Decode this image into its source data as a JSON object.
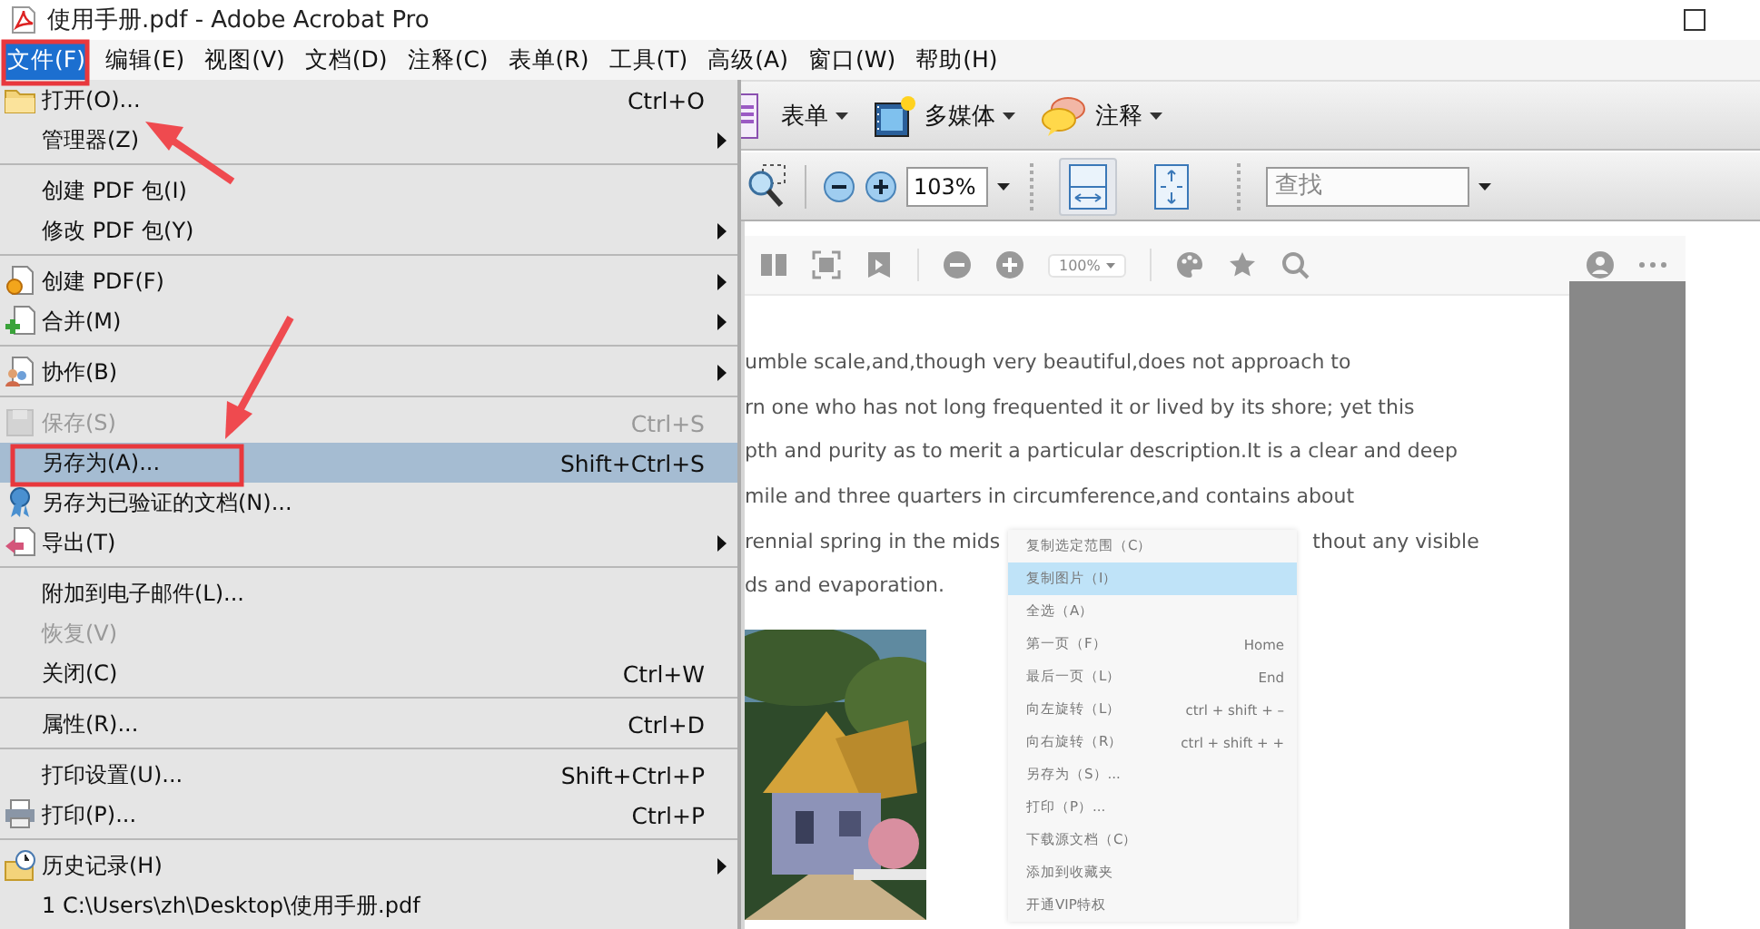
{
  "window": {
    "title": "使用手册.pdf - Adobe Acrobat Pro"
  },
  "menu_bar": [
    {
      "label": "文件(F)",
      "selected": true
    },
    {
      "label": "编辑(E)",
      "selected": false
    },
    {
      "label": "视图(V)",
      "selected": false
    },
    {
      "label": "文档(D)",
      "selected": false
    },
    {
      "label": "注释(C)",
      "selected": false
    },
    {
      "label": "表单(R)",
      "selected": false
    },
    {
      "label": "工具(T)",
      "selected": false
    },
    {
      "label": "高级(A)",
      "selected": false
    },
    {
      "label": "窗口(W)",
      "selected": false
    },
    {
      "label": "帮助(H)",
      "selected": false
    }
  ],
  "task_toolbar": [
    {
      "label": "表单"
    },
    {
      "label": "多媒体"
    },
    {
      "label": "注释"
    }
  ],
  "view_toolbar": {
    "zoom": "103%",
    "fit_buttons": [
      {
        "selected": true
      },
      {
        "selected": false
      }
    ],
    "search": {
      "placeholder": "查找"
    }
  },
  "file_menu": [
    [
      {
        "label": "打开(O)...",
        "shortcut": "Ctrl+O",
        "submenu": false,
        "disabled": false,
        "selected": false
      },
      {
        "label": "管理器(Z)",
        "submenu": true,
        "disabled": false,
        "selected": false
      }
    ],
    [
      {
        "label": "创建 PDF 包(I)",
        "submenu": false,
        "disabled": false,
        "selected": false
      },
      {
        "label": "修改 PDF 包(Y)",
        "submenu": true,
        "disabled": false,
        "selected": false
      }
    ],
    [
      {
        "label": "创建 PDF(F)",
        "submenu": true,
        "disabled": false,
        "selected": false
      },
      {
        "label": "合并(M)",
        "submenu": true,
        "disabled": false,
        "selected": false
      }
    ],
    [
      {
        "label": "协作(B)",
        "submenu": true,
        "disabled": false,
        "selected": false
      }
    ],
    [
      {
        "label": "保存(S)",
        "shortcut": "Ctrl+S",
        "submenu": false,
        "disabled": true,
        "selected": false
      },
      {
        "label": "另存为(A)...",
        "shortcut": "Shift+Ctrl+S",
        "submenu": false,
        "disabled": false,
        "selected": true
      },
      {
        "label": "另存为已验证的文档(N)...",
        "submenu": false,
        "disabled": false,
        "selected": false
      },
      {
        "label": "导出(T)",
        "submenu": true,
        "disabled": false,
        "selected": false
      }
    ],
    [
      {
        "label": "附加到电子邮件(L)...",
        "submenu": false,
        "disabled": false,
        "selected": false
      },
      {
        "label": "恢复(V)",
        "submenu": false,
        "disabled": true,
        "selected": false
      },
      {
        "label": "关闭(C)",
        "shortcut": "Ctrl+W",
        "submenu": false,
        "disabled": false,
        "selected": false
      }
    ],
    [
      {
        "label": "属性(R)...",
        "shortcut": "Ctrl+D",
        "submenu": false,
        "disabled": false,
        "selected": false
      }
    ],
    [
      {
        "label": "打印设置(U)...",
        "shortcut": "Shift+Ctrl+P",
        "submenu": false,
        "disabled": false,
        "selected": false
      },
      {
        "label": "打印(P)...",
        "shortcut": "Ctrl+P",
        "submenu": false,
        "disabled": false,
        "selected": false
      }
    ],
    [
      {
        "label": "历史记录(H)",
        "submenu": true,
        "disabled": false,
        "selected": false
      },
      {
        "label": "1 C:\\Users\\zh\\Desktop\\使用手册.pdf",
        "submenu": false,
        "disabled": false,
        "selected": false
      }
    ]
  ],
  "document": {
    "toolbar": {
      "zoom": "100%"
    },
    "lines": [
      [
        "umble scale,and,though very beautiful,does not approach to"
      ],
      [
        "rn one who has not long frequented it or lived by its shore; yet this"
      ],
      [
        "pth and purity as to merit a particular description.It is a clear and deep"
      ],
      [
        "mile and three quarters in circumference,and contains about"
      ],
      [
        "rennial spring in the mids",
        "thout any visible"
      ],
      [
        "ds and evaporation."
      ]
    ],
    "context_menu": [
      {
        "label": "复制选定范围（C）",
        "selected": false
      },
      {
        "label": "复制图片（I）",
        "selected": true
      },
      {
        "label": "全选（A）",
        "selected": false
      },
      {
        "label": "第一页（F）",
        "shortcut": "Home",
        "selected": false
      },
      {
        "label": "最后一页（L）",
        "shortcut": "End",
        "selected": false
      },
      {
        "label": "向左旋转（L）",
        "shortcut": "ctrl + shift + –",
        "selected": false
      },
      {
        "label": "向右旋转（R）",
        "shortcut": "ctrl + shift + +",
        "selected": false
      },
      {
        "label": "另存为（S）...",
        "selected": false
      },
      {
        "label": "打印（P）...",
        "selected": false
      },
      {
        "label": "下载源文档（C）",
        "selected": false
      },
      {
        "label": "添加到收藏夹",
        "selected": false
      },
      {
        "label": "开通VIP特权",
        "selected": false
      }
    ]
  }
}
